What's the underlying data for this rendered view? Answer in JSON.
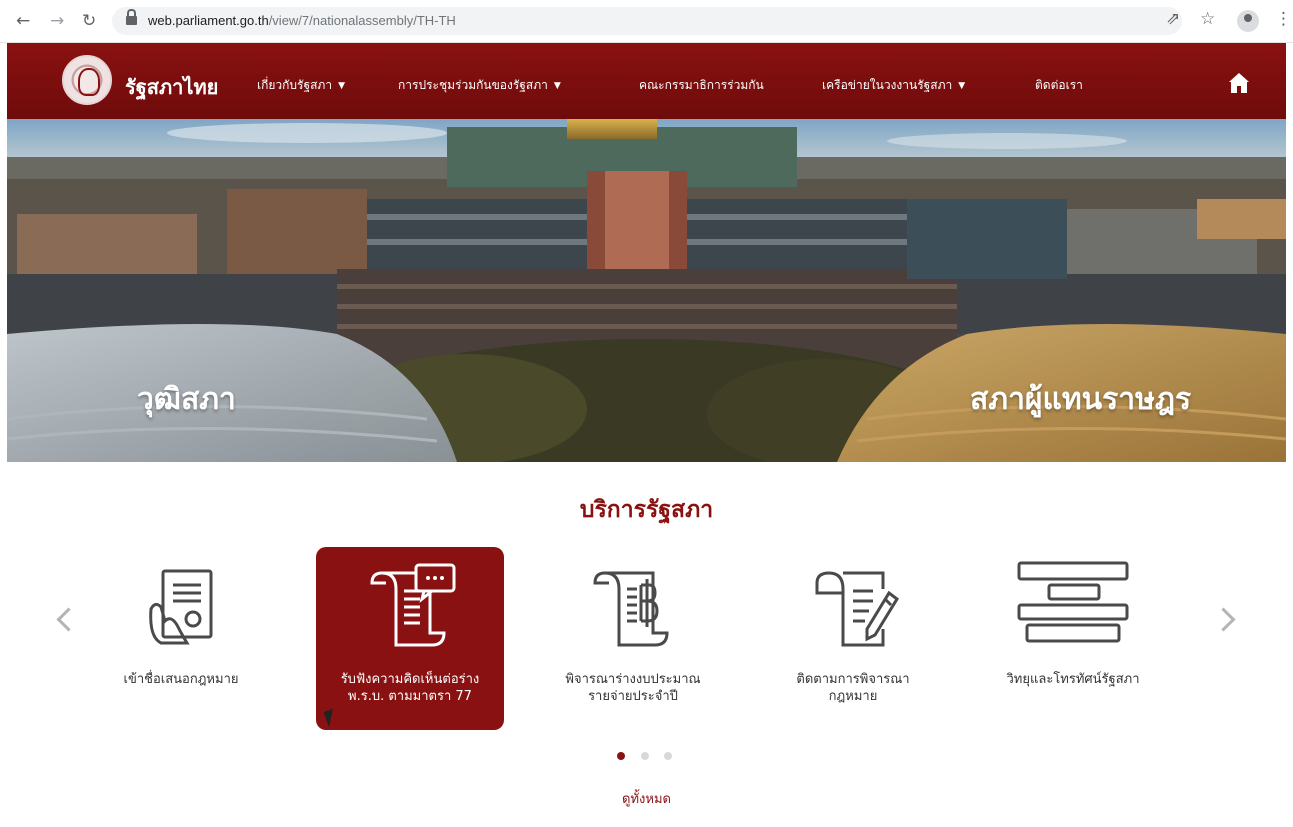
{
  "browser": {
    "back_icon": "arrow-left-icon",
    "forward_icon": "arrow-right-icon",
    "reload_icon": "reload-icon",
    "url_host": "web.parliament.go.th",
    "url_path": "/view/7/nationalassembly/TH-TH",
    "share_icon": "share-icon",
    "bookmark_icon": "star-icon",
    "profile_icon": "profile-icon",
    "menu_icon": "kebab-icon"
  },
  "header": {
    "brand": "รัฐสภาไทย",
    "menu": [
      {
        "label": "เกี่ยวกับรัฐสภา",
        "has_dropdown": true
      },
      {
        "label": "การประชุมร่วมกันของรัฐสภา",
        "has_dropdown": true
      },
      {
        "label": "คณะกรรมาธิการร่วมกัน",
        "has_dropdown": false
      },
      {
        "label": "เครือข่ายในวงงานรัฐสภา",
        "has_dropdown": true
      },
      {
        "label": "ติดต่อเรา",
        "has_dropdown": false
      }
    ],
    "home_icon": "home-icon"
  },
  "hero": {
    "left_label": "วุฒิสภา",
    "right_label": "สภาผู้แทนราษฎร"
  },
  "services": {
    "title": "บริการรัฐสภา",
    "items": [
      {
        "line1": "เข้าชื่อเสนอกฎหมาย",
        "line2": "",
        "icon": "petition-document-icon",
        "active": false
      },
      {
        "line1": "รับฟังความคิดเห็นต่อร่าง",
        "line2": "พ.ร.บ. ตามมาตรา 77",
        "icon": "scroll-comment-icon",
        "active": true
      },
      {
        "line1": "พิจารณาร่างงบประมาณ",
        "line2": "รายจ่ายประจำปี",
        "icon": "budget-scroll-icon",
        "active": false
      },
      {
        "line1": "ติดตามการพิจารณา",
        "line2": "กฎหมาย",
        "icon": "law-scroll-pen-icon",
        "active": false
      },
      {
        "line1": "วิทยุและโทรทัศน์รัฐสภา",
        "line2": "",
        "icon": "media-bars-icon",
        "active": false
      }
    ],
    "pagination_active": 1,
    "pagination_total": 3,
    "view_all": "ดูทั้งหมด"
  },
  "colors": {
    "brand_red": "#8a1111",
    "inactive_icon": "#4a4a4a",
    "arrow_gray": "#b4b4b4"
  }
}
